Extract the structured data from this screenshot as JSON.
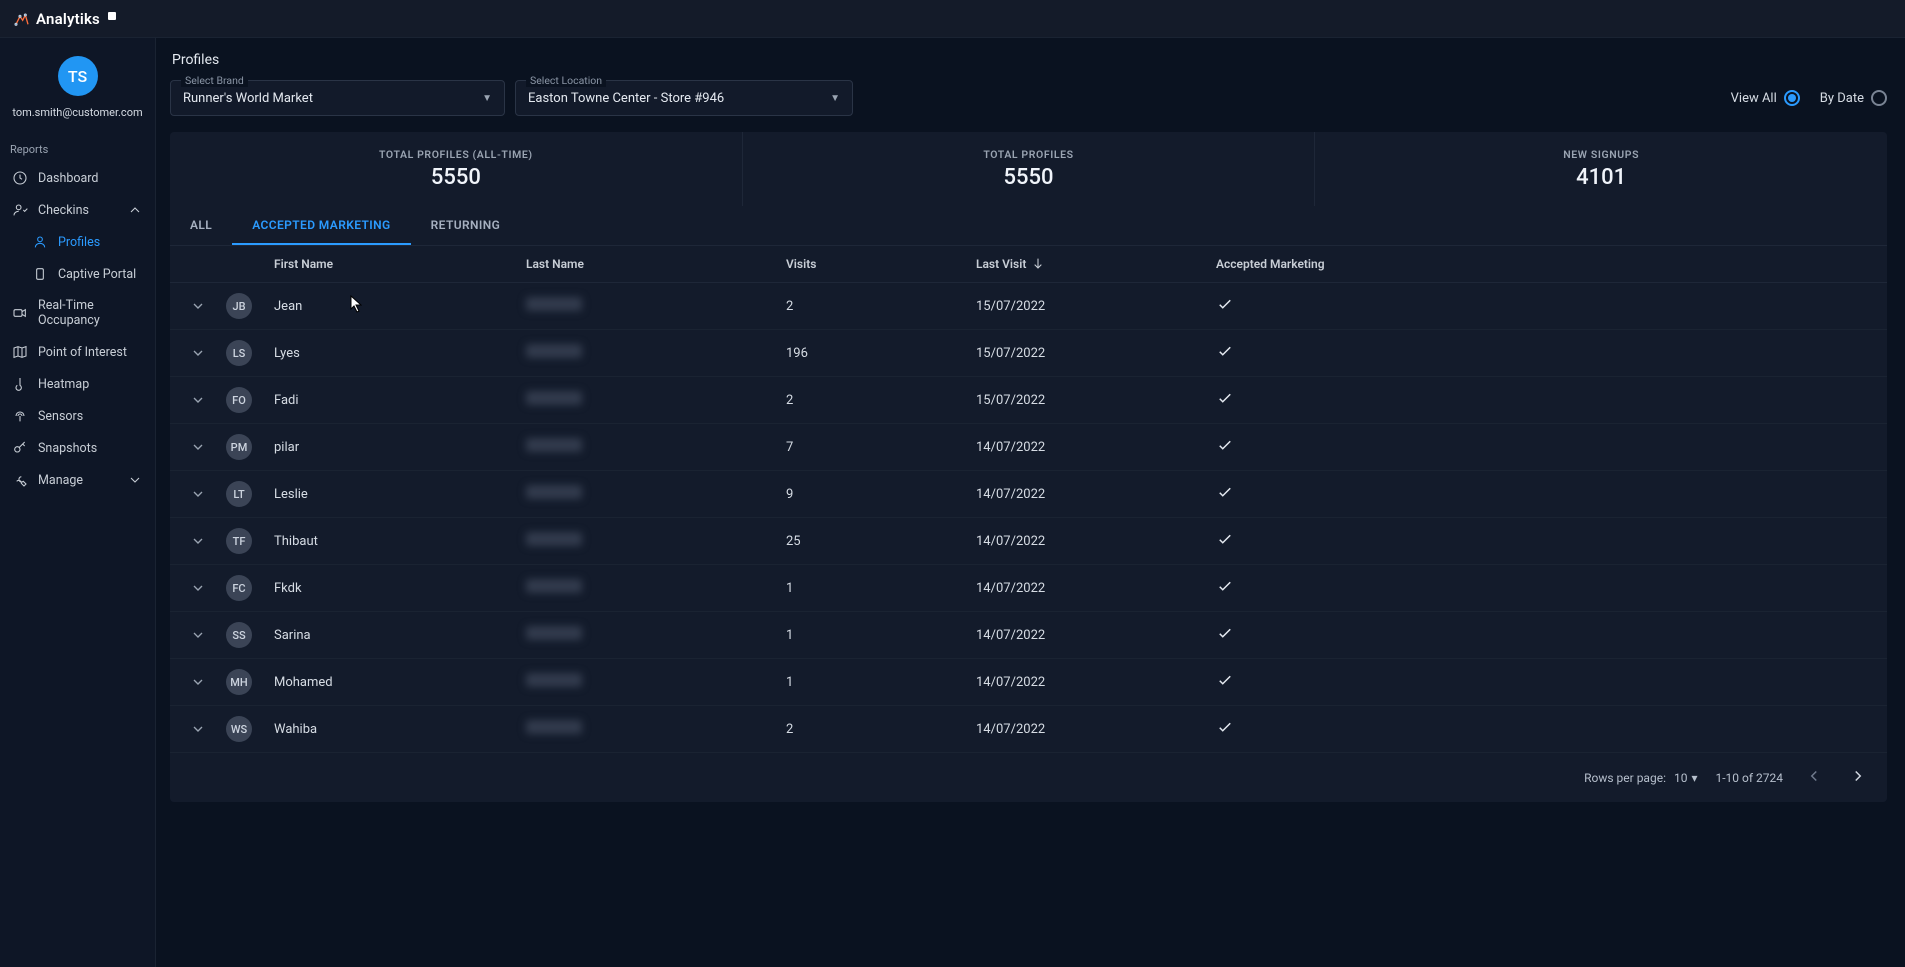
{
  "brand": "Analytiks",
  "user": {
    "initials": "TS",
    "email": "tom.smith@customer.com"
  },
  "sidebar": {
    "section": "Reports",
    "items": [
      {
        "label": "Dashboard"
      },
      {
        "label": "Checkins",
        "expanded": true
      },
      {
        "label": "Profiles",
        "active": true
      },
      {
        "label": "Captive Portal"
      },
      {
        "label": "Real-Time Occupancy"
      },
      {
        "label": "Point of Interest"
      },
      {
        "label": "Heatmap"
      },
      {
        "label": "Sensors"
      },
      {
        "label": "Snapshots"
      },
      {
        "label": "Manage",
        "collapsible": true
      }
    ]
  },
  "page": {
    "title": "Profiles",
    "brandSelect": {
      "label": "Select Brand",
      "value": "Runner's World Market"
    },
    "locationSelect": {
      "label": "Select Location",
      "value": "Easton Towne Center - Store #946"
    },
    "viewAll": "View All",
    "byDate": "By Date"
  },
  "stats": [
    {
      "label": "TOTAL PROFILES (ALL-TIME)",
      "value": "5550"
    },
    {
      "label": "TOTAL PROFILES",
      "value": "5550"
    },
    {
      "label": "NEW SIGNUPS",
      "value": "4101"
    }
  ],
  "tabs": {
    "all": "ALL",
    "accepted": "ACCEPTED MARKETING",
    "returning": "RETURNING"
  },
  "columns": {
    "first": "First Name",
    "last": "Last Name",
    "visits": "Visits",
    "lastVisit": "Last Visit",
    "accepted": "Accepted Marketing"
  },
  "rows": [
    {
      "initials": "JB",
      "first": "Jean",
      "visits": "2",
      "lastVisit": "15/07/2022",
      "accepted": true
    },
    {
      "initials": "LS",
      "first": "Lyes",
      "visits": "196",
      "lastVisit": "15/07/2022",
      "accepted": true
    },
    {
      "initials": "FO",
      "first": "Fadi",
      "visits": "2",
      "lastVisit": "15/07/2022",
      "accepted": true
    },
    {
      "initials": "PM",
      "first": "pilar",
      "visits": "7",
      "lastVisit": "14/07/2022",
      "accepted": true
    },
    {
      "initials": "LT",
      "first": "Leslie",
      "visits": "9",
      "lastVisit": "14/07/2022",
      "accepted": true
    },
    {
      "initials": "TF",
      "first": "Thibaut",
      "visits": "25",
      "lastVisit": "14/07/2022",
      "accepted": true
    },
    {
      "initials": "FC",
      "first": "Fkdk",
      "visits": "1",
      "lastVisit": "14/07/2022",
      "accepted": true
    },
    {
      "initials": "SS",
      "first": "Sarina",
      "visits": "1",
      "lastVisit": "14/07/2022",
      "accepted": true
    },
    {
      "initials": "MH",
      "first": "Mohamed",
      "visits": "1",
      "lastVisit": "14/07/2022",
      "accepted": true
    },
    {
      "initials": "WS",
      "first": "Wahiba",
      "visits": "2",
      "lastVisit": "14/07/2022",
      "accepted": true
    }
  ],
  "footer": {
    "rowsPerPageLabel": "Rows per page:",
    "rowsPerPage": "10",
    "range": "1-10 of 2724"
  }
}
